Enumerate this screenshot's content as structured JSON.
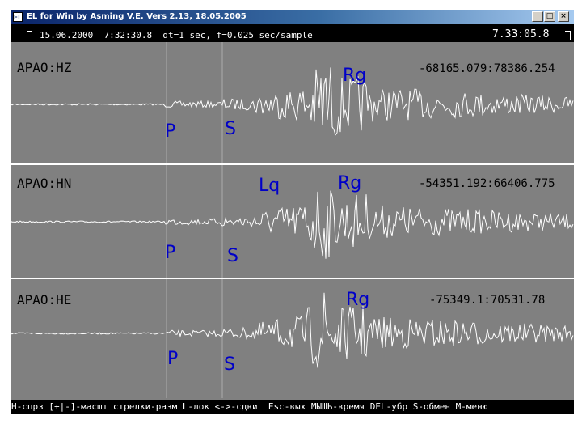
{
  "window": {
    "title": "EL for Win by Asming V.E. Vers 2.13, 18.05.2005",
    "icon_text": "EL",
    "controls": {
      "minimize": "_",
      "maximize": "□",
      "close": "×"
    }
  },
  "infobar": {
    "date": "15.06.2000",
    "time": "7:32:30.8",
    "dt": "dt=1 sec,",
    "f": "f=0.025 sec/sample",
    "cursor_time": "7.33:05.8"
  },
  "channels": [
    {
      "name": "APAO:HZ",
      "coords": "-68165.079:78386.254",
      "phases": [
        {
          "name": "P"
        },
        {
          "name": "S"
        },
        {
          "name": "Rg"
        }
      ]
    },
    {
      "name": "APAO:HN",
      "coords": "-54351.192:66406.775",
      "phases": [
        {
          "name": "P"
        },
        {
          "name": "S"
        },
        {
          "name": "Lq"
        },
        {
          "name": "Rg"
        }
      ]
    },
    {
      "name": "APAO:HE",
      "coords": "-75349.1:70531.78",
      "phases": [
        {
          "name": "P"
        },
        {
          "name": "S"
        },
        {
          "name": "Rg"
        }
      ]
    }
  ],
  "hotkeys": "H-спрз [+|-]-масшт стрелки-разм L-лок <->-сдвиг Esc-вых МЫШЬ-время DEL-убр S-обмен M-меню",
  "colors": {
    "background": "#808080",
    "trace": "#ffffff",
    "phase_label": "#0000c8",
    "bar": "#000000"
  }
}
